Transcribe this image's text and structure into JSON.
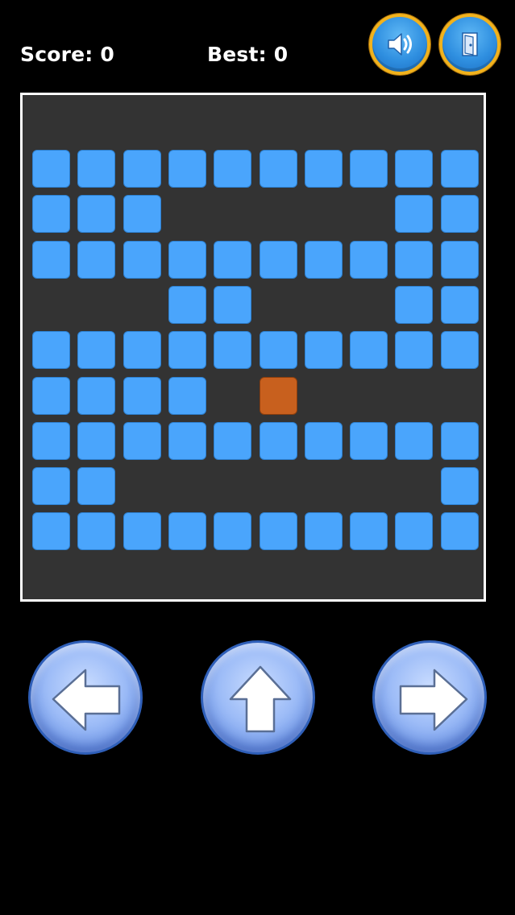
{
  "hud": {
    "score_label": "Score: 0",
    "best_label": "Best: 0"
  },
  "icons": {
    "sound": "speaker-icon",
    "exit": "door-icon",
    "left": "arrow-left-icon",
    "up": "arrow-up-icon",
    "right": "arrow-right-icon"
  },
  "colors": {
    "background": "#000000",
    "board": "#333333",
    "board_border": "#ffffff",
    "block": "#4aa5fc",
    "player": "#c8601e",
    "hud_button_ring": "#f2b21c"
  },
  "grid": {
    "columns": 10,
    "rows": 9,
    "cells": [
      "##########",
      "###.....##",
      "##########",
      "...##...###",
      "##########",
      "####.P....",
      "##########",
      "##.......#",
      "##########"
    ]
  }
}
